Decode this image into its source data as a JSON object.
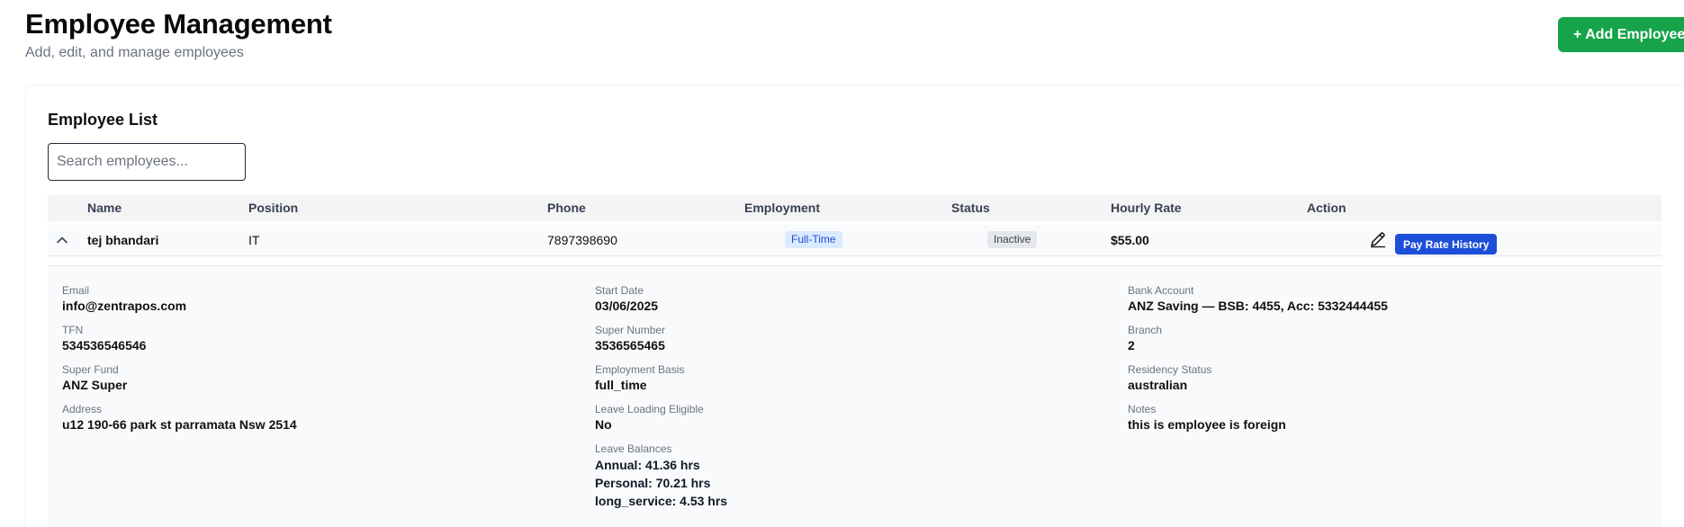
{
  "header": {
    "title": "Employee Management",
    "subtitle": "Add, edit, and manage employees",
    "add_button_label": "+ Add Employee"
  },
  "list": {
    "title": "Employee List",
    "search_placeholder": "Search employees...",
    "columns": [
      "Name",
      "Position",
      "Phone",
      "Employment",
      "Status",
      "Hourly Rate",
      "Action"
    ]
  },
  "employee": {
    "name": "tej bhandari",
    "position": "IT",
    "phone": "7897398690",
    "employment": "Full-Time",
    "status": "Inactive",
    "hourly_rate": "$55.00",
    "pay_rate_history_label": "Pay Rate History",
    "details": {
      "email": {
        "label": "Email",
        "value": "info@zentrapos.com"
      },
      "tfn": {
        "label": "TFN",
        "value": "534536546546"
      },
      "super_fund": {
        "label": "Super Fund",
        "value": "ANZ Super"
      },
      "address": {
        "label": "Address",
        "value": "u12 190-66 park st parramata Nsw 2514"
      },
      "start_date": {
        "label": "Start Date",
        "value": "03/06/2025"
      },
      "super_number": {
        "label": "Super Number",
        "value": "3536565465"
      },
      "employment_basis": {
        "label": "Employment Basis",
        "value": "full_time"
      },
      "leave_loading": {
        "label": "Leave Loading Eligible",
        "value": "No"
      },
      "leave_balances": {
        "label": "Leave Balances",
        "lines": [
          "Annual: 41.36 hrs",
          "Personal: 70.21 hrs",
          "long_service: 4.53 hrs"
        ]
      },
      "bank_account": {
        "label": "Bank Account",
        "value": "ANZ Saving — BSB: 4455, Acc: 5332444455"
      },
      "branch": {
        "label": "Branch",
        "value": "2"
      },
      "residency": {
        "label": "Residency Status",
        "value": "australian"
      },
      "notes": {
        "label": "Notes",
        "value": "this is employee is foreign"
      }
    }
  },
  "icons": {
    "expand_toggle": "chevron-up-icon",
    "edit": "pencil-icon"
  },
  "colors": {
    "primary_green": "#16a34a",
    "primary_blue": "#1d4ed8",
    "badge_fulltime_bg": "#dbeafe",
    "badge_inactive_bg": "#e5e7eb"
  }
}
